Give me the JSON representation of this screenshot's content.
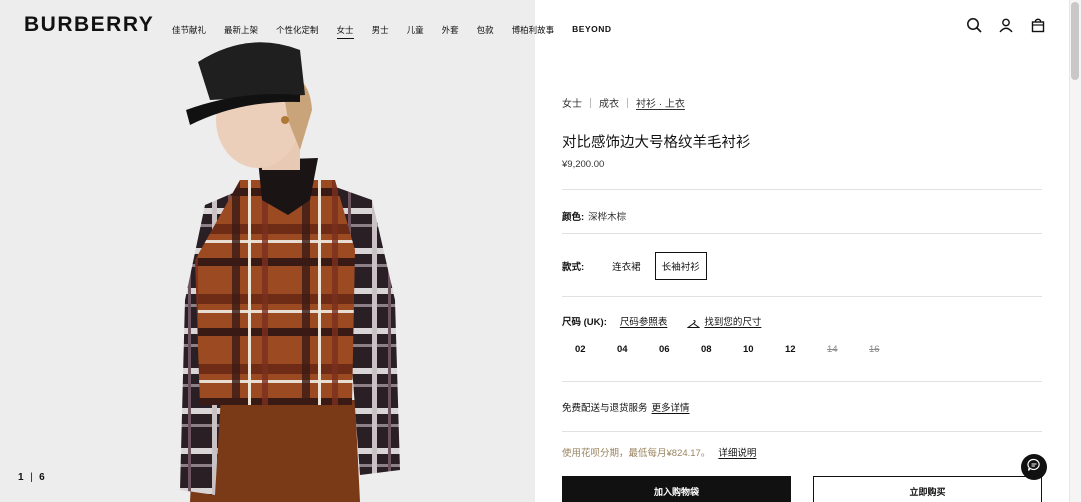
{
  "brand": {
    "logo": "BURBERRY"
  },
  "nav": {
    "items": [
      "佳节献礼",
      "最新上架",
      "个性化定制",
      "女士",
      "男士",
      "儿童",
      "外套",
      "包款",
      "博柏利故事",
      "BEYOND"
    ],
    "active": "女士"
  },
  "header_icons": [
    "search-icon",
    "account-icon",
    "bag-icon"
  ],
  "gallery": {
    "current": "1",
    "separator": "|",
    "total": "6"
  },
  "breadcrumb": [
    "女士",
    "成衣",
    "衬衫 · 上衣"
  ],
  "product": {
    "title": "对比感饰边大号格纹羊毛衬衫",
    "price": "¥9,200.00"
  },
  "color": {
    "label": "颜色:",
    "value": "深桦木棕"
  },
  "style": {
    "label": "款式:",
    "options": [
      "连衣裙",
      "长袖衬衫"
    ],
    "selected": "长袖衬衫"
  },
  "size": {
    "label": "尺码 (UK):",
    "guide_link": "尺码参照表",
    "find_link": "找到您的尺寸",
    "options": [
      {
        "value": "02",
        "available": true
      },
      {
        "value": "04",
        "available": true
      },
      {
        "value": "06",
        "available": true
      },
      {
        "value": "08",
        "available": true
      },
      {
        "value": "10",
        "available": true
      },
      {
        "value": "12",
        "available": true
      },
      {
        "value": "14",
        "available": false
      },
      {
        "value": "16",
        "available": false
      }
    ]
  },
  "delivery": {
    "text": "免费配送与退货服务",
    "link": "更多详情"
  },
  "installment": {
    "text": "使用花呗分期，最低每月¥824.17。",
    "link": "详细说明"
  },
  "actions": {
    "add_to_bag": "加入购物袋",
    "buy_now": "立即购买"
  },
  "colors": {
    "accent": "#111111",
    "installment_text": "#9a8460",
    "panel_bg": "#ececec"
  }
}
